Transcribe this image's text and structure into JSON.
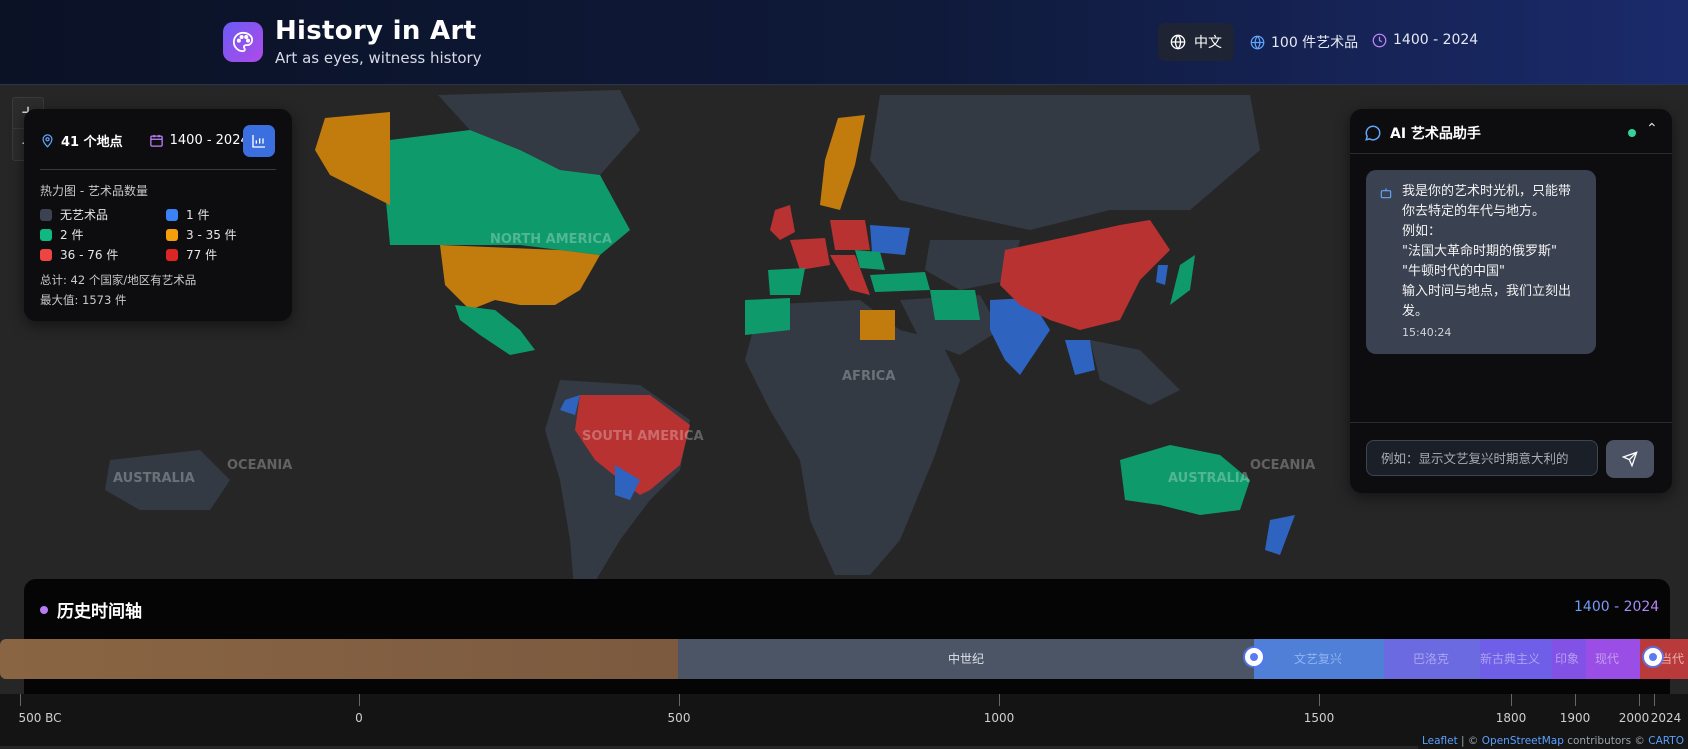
{
  "header": {
    "title": "History in Art",
    "subtitle": "Art as eyes, witness history",
    "lang_label": "中文",
    "artworks_count": "100 件艺术品",
    "year_range": "1400 - 2024"
  },
  "map": {
    "labels": [
      "NORTH AMERICA",
      "SOUTH AMERICA",
      "AFRICA",
      "AUSTRALIA",
      "OCEANIA",
      "AUSTRALIA",
      "OCEANIA"
    ],
    "zoom_in": "+",
    "zoom_out": "−"
  },
  "stats": {
    "locations": "41 个地点",
    "years": "1400 - 2024",
    "legend_title": "热力图 - 艺术品数量",
    "legend": [
      {
        "label": "无艺术品",
        "color": "#3b4252"
      },
      {
        "label": "1 件",
        "color": "#3b82f6"
      },
      {
        "label": "2 件",
        "color": "#10b981"
      },
      {
        "label": "3 - 35 件",
        "color": "#f59e0b"
      },
      {
        "label": "36 - 76 件",
        "color": "#ef4444"
      },
      {
        "label": "77 件",
        "color": "#dc2626"
      }
    ],
    "total": "总计: 42 个国家/地区有艺术品",
    "max": "最大值: 1573 件"
  },
  "ai": {
    "title": "AI 艺术品助手",
    "message": "我是你的艺术时光机，只能带你去特定的年代与地方。\n例如：\n\"法国大革命时期的俄罗斯\"\n\"牛顿时代的中国\"\n输入时间与地点，我们立刻出发。",
    "time": "15:40:24",
    "input_placeholder": "例如：显示文艺复兴时期意大利的"
  },
  "timeline": {
    "title": "历史时间轴",
    "range": "1400 - 2024",
    "eras": [
      "中世纪",
      "文艺复兴",
      "巴洛克",
      "新古典主义",
      "印象",
      "现代",
      "当代"
    ],
    "ticks": [
      "500 BC",
      "0",
      "500",
      "1000",
      "1500",
      "1800",
      "1900",
      "2000",
      "2024"
    ]
  },
  "attribution": {
    "leaflet": "Leaflet",
    "sep1": " | © ",
    "osm": "OpenStreetMap",
    "contributors": " contributors © ",
    "carto": "CARTO"
  },
  "colors": {
    "none": "#3b4252",
    "one": "#3b82f6",
    "two": "#10b981",
    "mid": "#f59e0b",
    "high": "#ef4444",
    "max": "#dc2626"
  }
}
